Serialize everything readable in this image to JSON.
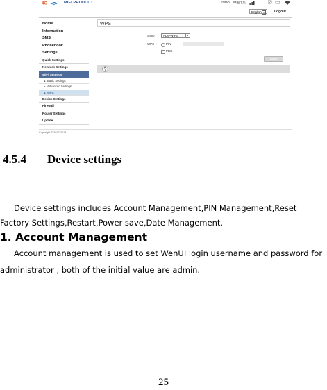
{
  "screenshot": {
    "header": {
      "product_name": "MIFI PRODUCT",
      "network_type": "EVDO",
      "carrier": "中国电信",
      "language": "English",
      "logout_label": "Logout"
    },
    "sidebar": {
      "top_items": [
        "Home",
        "Information",
        "SMS",
        "Phonebook",
        "Settings"
      ],
      "sub_items_before": [
        "Quick Settings",
        "Network Settings",
        "WiFi Settings"
      ],
      "wifi_children": [
        "Basic Settings",
        "Advanced Settings",
        "WPS"
      ],
      "sub_items_after": [
        "Device Settings",
        "Firewall",
        "Router Settings",
        "Update"
      ],
      "highlighted": "WiFi Settings",
      "selected_child": "WPS"
    },
    "main": {
      "title": "WPS",
      "ssid_label": "SSID",
      "ssid_value": "ALN-WIFI1",
      "wps_label": "WPS",
      "wps_required_mark": "*",
      "option_pin": "PIN",
      "option_pbc": "PBC",
      "apply_label": "Apply"
    },
    "copyright": "Copyright © 2012-2014 ."
  },
  "document": {
    "section_number": "4.5.4",
    "section_title": "Device settings",
    "paragraph1": "Device settings includes Account Management,PIN Management,Reset Factory Settings,Restart,Power save,Date Management.",
    "subheading": "1. Account Management",
    "paragraph2": "Account management is used to set WenUI login username and password for administrator , both of the initial value are admin.",
    "page_number": "25"
  },
  "colors": {
    "brand_blue": "#1f4e92",
    "sidebar_highlight": "#4d6c9a",
    "selected_child": "#cfe0ee"
  }
}
